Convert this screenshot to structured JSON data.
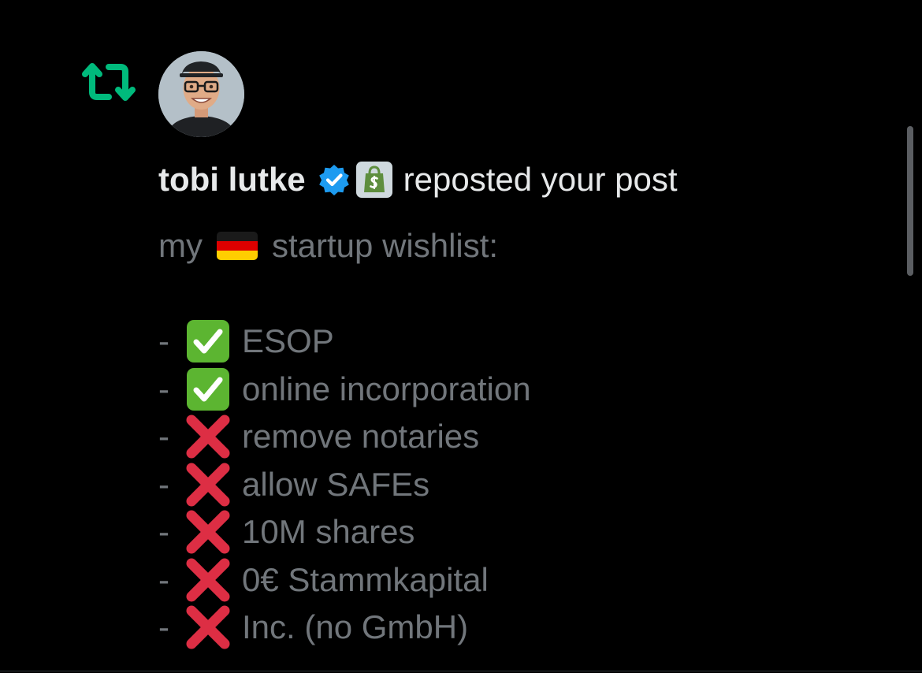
{
  "notification": {
    "user_name": "tobi lutke",
    "action_text": "reposted your post",
    "avatar_icon": "profile-photo",
    "verified_icon": "verified-badge-icon",
    "affiliate_icon": "shopify-bag-icon",
    "repost_icon": "repost-icon"
  },
  "post": {
    "intro_before": "my",
    "intro_flag": "germany-flag",
    "intro_after": "startup wishlist:",
    "items": [
      {
        "dash": "-",
        "status": "done",
        "text": "ESOP"
      },
      {
        "dash": "-",
        "status": "done",
        "text": "online incorporation"
      },
      {
        "dash": "-",
        "status": "not-done",
        "text": "remove notaries"
      },
      {
        "dash": "-",
        "status": "not-done",
        "text": "allow SAFEs"
      },
      {
        "dash": "-",
        "status": "not-done",
        "text": "10M shares"
      },
      {
        "dash": "-",
        "status": "not-done",
        "text": "0€ Stammkapital"
      },
      {
        "dash": "-",
        "status": "not-done",
        "text": "Inc. (no GmbH)"
      }
    ]
  },
  "colors": {
    "background": "#000000",
    "primary_text": "#e7e9ea",
    "secondary_text": "#71767b",
    "repost_green": "#00ba7c",
    "verified_blue": "#1d9bf0",
    "check_green": "#5cb531",
    "cross_red": "#dd2e44"
  }
}
